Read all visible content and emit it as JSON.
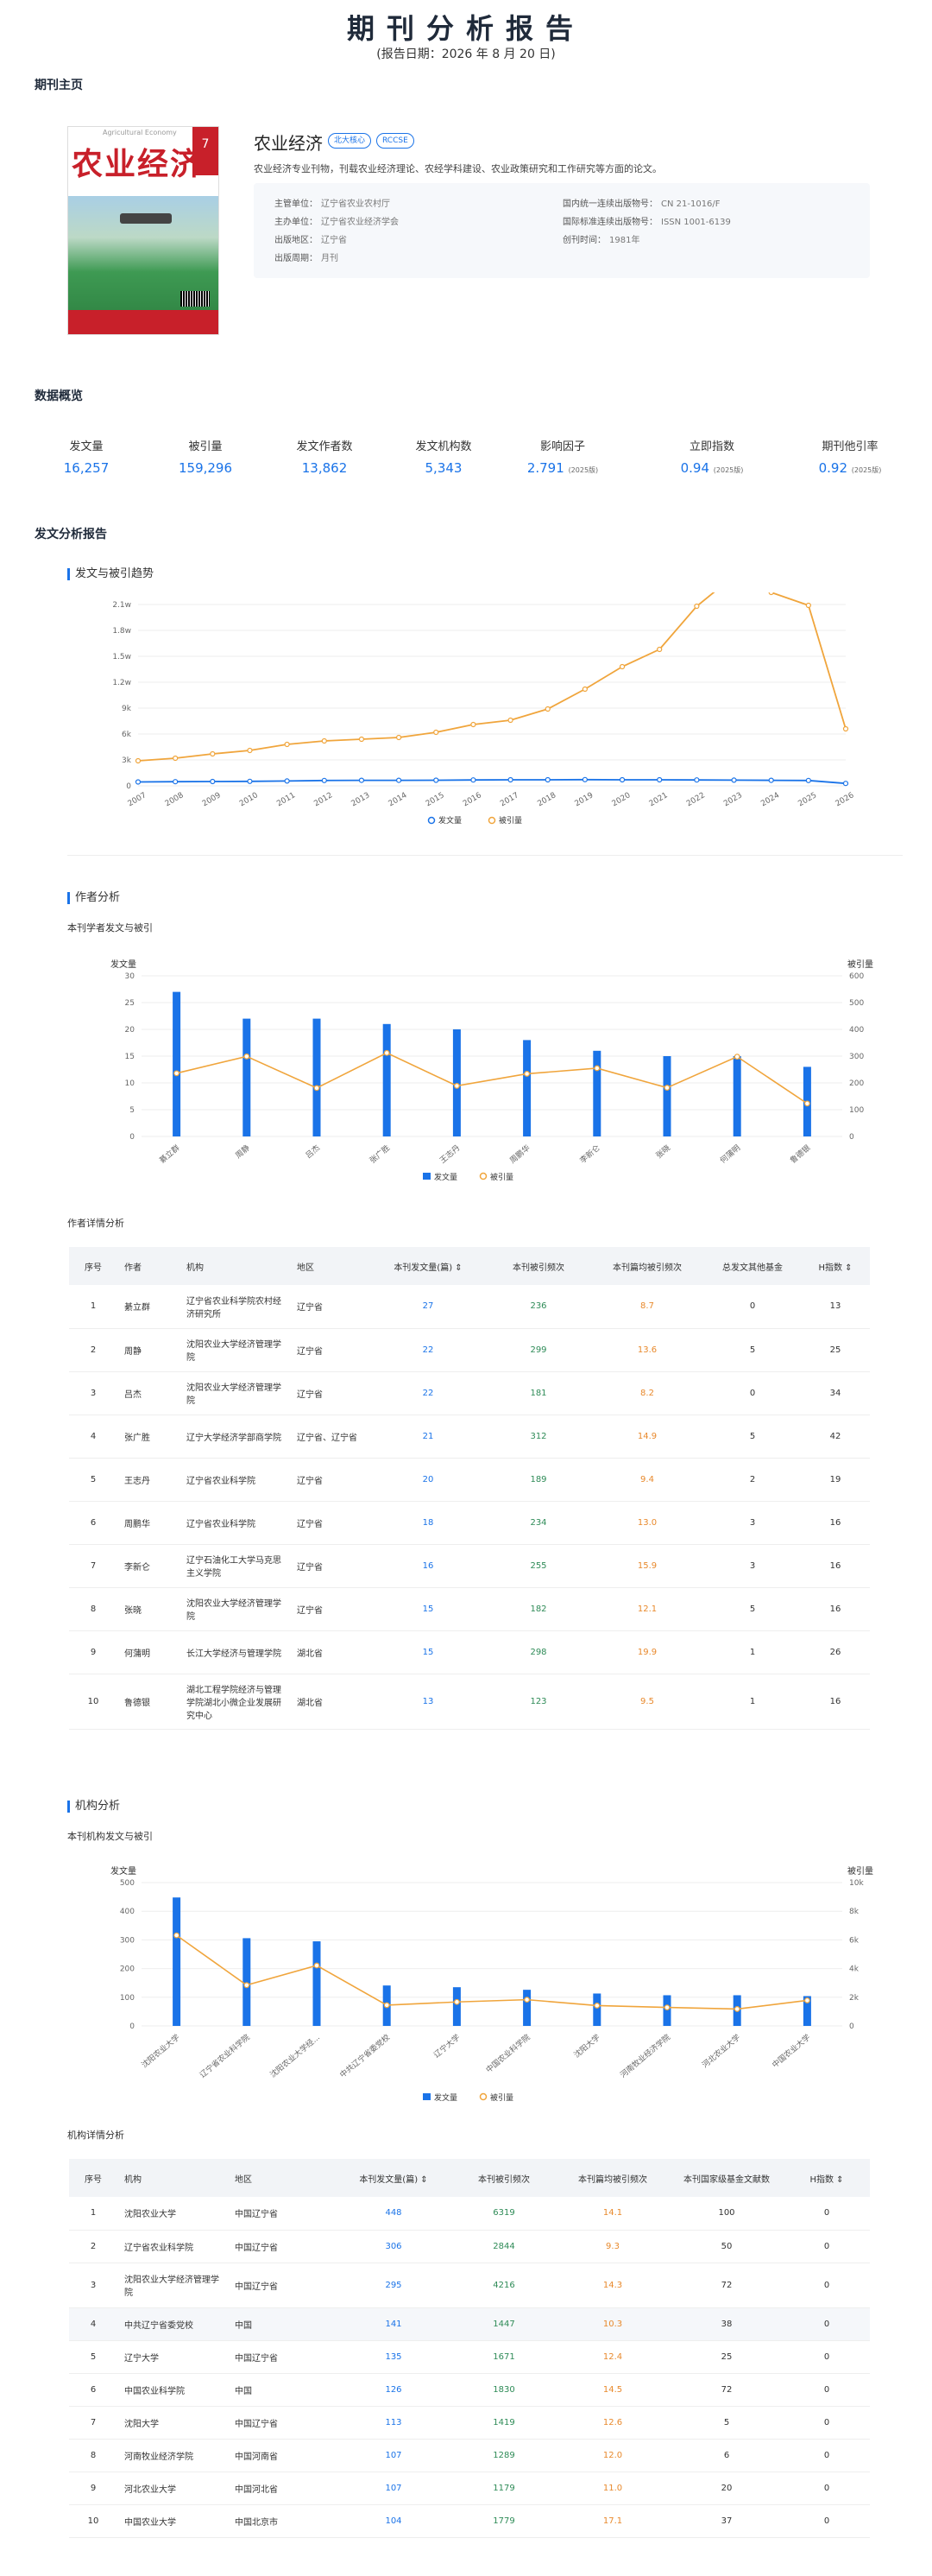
{
  "report": {
    "title": "期刊分析报告",
    "date_text": "(报告日期：2026 年 8 月 20 日)"
  },
  "sections": {
    "homepage": "期刊主页",
    "overview": "数据概览",
    "analysis": "发文分析报告",
    "trend": "发文与被引趋势",
    "author": "作者分析",
    "author_chart": "本刊学者发文与被引",
    "author_table": "作者详情分析",
    "org": "机构分析",
    "org_chart": "本刊机构发文与被引",
    "org_table": "机构详情分析"
  },
  "journal": {
    "name": "农业经济",
    "tags": [
      "北大核心",
      "RCCSE"
    ],
    "description": "农业经济专业刊物，刊载农业经济理论、农经学科建设、农业政策研究和工作研究等方面的论文。",
    "cover_title": "农业经济",
    "cover_en": "Agricultural Economy",
    "cover_issue": "7",
    "info_left": [
      {
        "label": "主管单位：",
        "value": "辽宁省农业农村厅"
      },
      {
        "label": "主办单位：",
        "value": "辽宁省农业经济学会"
      },
      {
        "label": "出版地区：",
        "value": "辽宁省"
      },
      {
        "label": "出版周期：",
        "value": "月刊"
      }
    ],
    "info_right": [
      {
        "label": "国内统一连续出版物号：",
        "value": "CN 21-1016/F"
      },
      {
        "label": "国际标准连续出版物号：",
        "value": "ISSN 1001-6139"
      },
      {
        "label": "创刊时间：",
        "value": "1981年"
      }
    ]
  },
  "overview": [
    {
      "label": "发文量",
      "value": "16,257",
      "suffix": ""
    },
    {
      "label": "被引量",
      "value": "159,296",
      "suffix": ""
    },
    {
      "label": "发文作者数",
      "value": "13,862",
      "suffix": ""
    },
    {
      "label": "发文机构数",
      "value": "5,343",
      "suffix": ""
    },
    {
      "label": "影响因子",
      "value": "2.791",
      "suffix": "(2025版)"
    },
    {
      "label": "立即指数",
      "value": "0.94",
      "suffix": "(2025版)"
    },
    {
      "label": "期刊他引率",
      "value": "0.92",
      "suffix": "(2025版)"
    }
  ],
  "colors": {
    "blue": "#1a73e8",
    "orange": "#f0a53c",
    "green": "#2e8b57",
    "accent_orange": "#e8892c"
  },
  "chart_data": [
    {
      "type": "line",
      "x": [
        "2007",
        "2008",
        "2009",
        "2010",
        "2011",
        "2012",
        "2013",
        "2014",
        "2015",
        "2016",
        "2017",
        "2018",
        "2019",
        "2020",
        "2021",
        "2022",
        "2023",
        "2024",
        "2025",
        "2026"
      ],
      "series": [
        {
          "name": "发文量",
          "values": [
            450,
            480,
            500,
            520,
            560,
            620,
            640,
            640,
            650,
            680,
            700,
            700,
            720,
            700,
            700,
            680,
            660,
            640,
            620,
            280
          ]
        },
        {
          "name": "被引量",
          "values": [
            2900,
            3200,
            3700,
            4100,
            4800,
            5200,
            5400,
            5600,
            6200,
            7100,
            7600,
            8900,
            11200,
            13800,
            15800,
            20800,
            24300,
            22400,
            20900,
            6600
          ]
        }
      ],
      "ylim": [
        0,
        21000
      ],
      "yticks": [
        "0",
        "3k",
        "6k",
        "9k",
        "1.2w",
        "1.5w",
        "1.8w",
        "2.1w"
      ],
      "legend": "bottom"
    },
    {
      "type": "bar",
      "categories": [
        "綦立群",
        "周静",
        "吕杰",
        "张广胜",
        "王志丹",
        "周鹏华",
        "李新仑",
        "张晓",
        "何蒲明",
        "鲁德银"
      ],
      "series": [
        {
          "name": "发文量",
          "values": [
            27,
            22,
            22,
            21,
            20,
            18,
            16,
            15,
            15,
            13
          ]
        },
        {
          "name": "被引量",
          "values": [
            236,
            299,
            181,
            312,
            189,
            234,
            255,
            182,
            298,
            123
          ]
        }
      ],
      "ylabel": "发文量",
      "y2label": "被引量",
      "ylim": [
        0,
        30
      ],
      "y2lim": [
        0,
        600
      ],
      "yticks": [
        "0",
        "5",
        "10",
        "15",
        "20",
        "25",
        "30"
      ],
      "y2ticks": [
        "0",
        "100",
        "200",
        "300",
        "400",
        "500",
        "600"
      ],
      "legend": "bottom"
    },
    {
      "type": "bar",
      "categories": [
        "沈阳农业大学",
        "辽宁省农业科学院",
        "沈阳农业大学经...",
        "中共辽宁省委党校",
        "辽宁大学",
        "中国农业科学院",
        "沈阳大学",
        "河南牧业经济学院",
        "河北农业大学",
        "中国农业大学"
      ],
      "series": [
        {
          "name": "发文量",
          "values": [
            448,
            306,
            295,
            141,
            135,
            126,
            113,
            107,
            107,
            104
          ]
        },
        {
          "name": "被引量",
          "values": [
            6319,
            2844,
            4216,
            1447,
            1671,
            1830,
            1419,
            1289,
            1179,
            1779
          ]
        }
      ],
      "ylabel": "发文量",
      "y2label": "被引量",
      "ylim": [
        0,
        500
      ],
      "y2lim": [
        0,
        10000
      ],
      "yticks": [
        "0",
        "100",
        "200",
        "300",
        "400",
        "500"
      ],
      "y2ticks": [
        "0",
        "2k",
        "4k",
        "6k",
        "8k",
        "10k"
      ],
      "legend": "bottom"
    }
  ],
  "author_table": {
    "headers": [
      "序号",
      "作者",
      "机构",
      "地区",
      "本刊发文量(篇) ⇕",
      "本刊被引频次",
      "本刊篇均被引频次",
      "总发文其他基金",
      "H指数 ⇕"
    ],
    "rows": [
      [
        "1",
        "綦立群",
        "辽宁省农业科学院农村经济研究所",
        "辽宁省",
        "27",
        "236",
        "8.7",
        "0",
        "13"
      ],
      [
        "2",
        "周静",
        "沈阳农业大学经济管理学院",
        "辽宁省",
        "22",
        "299",
        "13.6",
        "5",
        "25"
      ],
      [
        "3",
        "吕杰",
        "沈阳农业大学经济管理学院",
        "辽宁省",
        "22",
        "181",
        "8.2",
        "0",
        "34"
      ],
      [
        "4",
        "张广胜",
        "辽宁大学经济学部商学院",
        "辽宁省、辽宁省",
        "21",
        "312",
        "14.9",
        "5",
        "42"
      ],
      [
        "5",
        "王志丹",
        "辽宁省农业科学院",
        "辽宁省",
        "20",
        "189",
        "9.4",
        "2",
        "19"
      ],
      [
        "6",
        "周鹏华",
        "辽宁省农业科学院",
        "辽宁省",
        "18",
        "234",
        "13.0",
        "3",
        "16"
      ],
      [
        "7",
        "李新仑",
        "辽宁石油化工大学马克思主义学院",
        "辽宁省",
        "16",
        "255",
        "15.9",
        "3",
        "16"
      ],
      [
        "8",
        "张晓",
        "沈阳农业大学经济管理学院",
        "辽宁省",
        "15",
        "182",
        "12.1",
        "5",
        "16"
      ],
      [
        "9",
        "何蒲明",
        "长江大学经济与管理学院",
        "湖北省",
        "15",
        "298",
        "19.9",
        "1",
        "26"
      ],
      [
        "10",
        "鲁德银",
        "湖北工程学院经济与管理学院湖北小微企业发展研究中心",
        "湖北省",
        "13",
        "123",
        "9.5",
        "1",
        "16"
      ]
    ]
  },
  "org_table": {
    "headers": [
      "序号",
      "机构",
      "地区",
      "本刊发文量(篇) ⇕",
      "本刊被引频次",
      "本刊篇均被引频次",
      "本刊国家级基金文献数",
      "H指数 ⇕"
    ],
    "rows": [
      [
        "1",
        "沈阳农业大学",
        "中国辽宁省",
        "448",
        "6319",
        "14.1",
        "100",
        "0"
      ],
      [
        "2",
        "辽宁省农业科学院",
        "中国辽宁省",
        "306",
        "2844",
        "9.3",
        "50",
        "0"
      ],
      [
        "3",
        "沈阳农业大学经济管理学院",
        "中国辽宁省",
        "295",
        "4216",
        "14.3",
        "72",
        "0"
      ],
      [
        "4",
        "中共辽宁省委党校",
        "中国",
        "141",
        "1447",
        "10.3",
        "38",
        "0"
      ],
      [
        "5",
        "辽宁大学",
        "中国辽宁省",
        "135",
        "1671",
        "12.4",
        "25",
        "0"
      ],
      [
        "6",
        "中国农业科学院",
        "中国",
        "126",
        "1830",
        "14.5",
        "72",
        "0"
      ],
      [
        "7",
        "沈阳大学",
        "中国辽宁省",
        "113",
        "1419",
        "12.6",
        "5",
        "0"
      ],
      [
        "8",
        "河南牧业经济学院",
        "中国河南省",
        "107",
        "1289",
        "12.0",
        "6",
        "0"
      ],
      [
        "9",
        "河北农业大学",
        "中国河北省",
        "107",
        "1179",
        "11.0",
        "20",
        "0"
      ],
      [
        "10",
        "中国农业大学",
        "中国北京市",
        "104",
        "1779",
        "17.1",
        "37",
        "0"
      ]
    ]
  }
}
